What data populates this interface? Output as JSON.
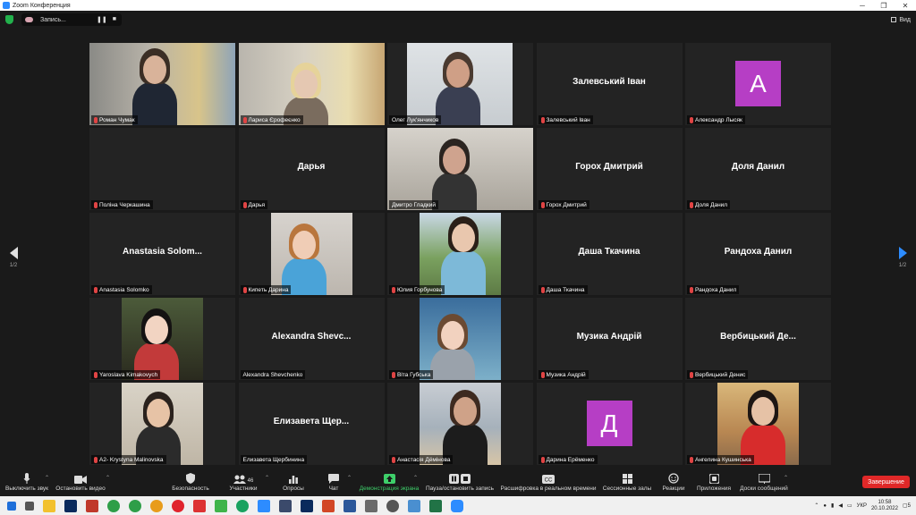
{
  "window": {
    "title": "Zoom Конференция",
    "controls": [
      "─",
      "❐",
      "✕"
    ]
  },
  "topbar": {
    "recording_label": "Запись...",
    "view_label": "Вид"
  },
  "pagination": {
    "left": "1/2",
    "right": "1/2"
  },
  "participants": [
    {
      "name": "Роман Чумак",
      "type": "photo",
      "muted": true
    },
    {
      "name": "Лариса Єрофеєнко",
      "type": "photo",
      "muted": true
    },
    {
      "name": "Олег Лук'янчиков",
      "type": "photo",
      "muted": false
    },
    {
      "name": "Залевський Іван",
      "type": "name",
      "display": "Залевський Іван",
      "muted": true
    },
    {
      "name": "Александр Лысяк",
      "type": "avatar",
      "letter": "A",
      "color": "#b63ec5",
      "muted": true
    },
    {
      "name": "Поліна Черкашина",
      "type": "blank",
      "muted": true
    },
    {
      "name": "Дарья",
      "type": "name",
      "display": "Дарья",
      "muted": true
    },
    {
      "name": "Дмитро Гладкий",
      "type": "photo",
      "muted": false,
      "active": true
    },
    {
      "name": "Горох Дмитрий",
      "type": "name",
      "display": "Горох Дмитрий",
      "muted": true
    },
    {
      "name": "Доля Данил",
      "type": "name",
      "display": "Доля Данил",
      "muted": true
    },
    {
      "name": "Anastasia Solomko",
      "type": "name",
      "display": "Anastasia Solom...",
      "muted": true
    },
    {
      "name": "Кипеть Дарина",
      "type": "photo",
      "muted": true
    },
    {
      "name": "Юлия Горбунова",
      "type": "photo",
      "muted": true
    },
    {
      "name": "Даша Ткачина",
      "type": "name",
      "display": "Даша Ткачина",
      "muted": true
    },
    {
      "name": "Рандоха Данил",
      "type": "name",
      "display": "Рандоха Данил",
      "muted": true
    },
    {
      "name": "Yaroslava Kimakovych",
      "type": "photo",
      "muted": true
    },
    {
      "name": "Alexandra Shevchenko",
      "type": "name",
      "display": "Alexandra Shevc...",
      "muted": false
    },
    {
      "name": "Віта Губська",
      "type": "photo",
      "muted": true
    },
    {
      "name": "Музика Андрій",
      "type": "name",
      "display": "Музика Андрій",
      "muted": true
    },
    {
      "name": "Вербицький Денис",
      "type": "name",
      "display": "Вербицький Де...",
      "muted": true
    },
    {
      "name": "A2- Krystyna Malinovska",
      "type": "photo",
      "muted": true
    },
    {
      "name": "Елизавета Щербинина",
      "type": "name",
      "display": "Елизавета Щер...",
      "muted": false
    },
    {
      "name": "Анастасія Дёмінова",
      "type": "photo",
      "muted": true
    },
    {
      "name": "Дарина Ерёменко",
      "type": "avatar",
      "letter": "Д",
      "color": "#b63ec5",
      "muted": true
    },
    {
      "name": "Ангелина Кушинська",
      "type": "photo",
      "muted": true
    }
  ],
  "toolbar": {
    "mute": "Выключить звук",
    "video": "Остановить видео",
    "security": "Безопасность",
    "participants": "Участники",
    "participants_count": "46",
    "polls": "Опросы",
    "chat": "Чат",
    "share": "Демонстрация экрана",
    "pause_recording": "Пауза/остановить запись",
    "captions": "Расшифровка в реальном времени",
    "breakout": "Сессионные залы",
    "reactions": "Реакции",
    "apps": "Приложения",
    "whiteboard": "Доски сообщений",
    "end": "Завершение"
  },
  "taskbar": {
    "lang": "УКР",
    "time": "10:58",
    "date": "20.10.2022",
    "notifications": "5"
  },
  "colors": {
    "accent": "#2d8cff",
    "end": "#e02828",
    "active_speaker": "#e9e36a",
    "avatar": "#b63ec5"
  }
}
